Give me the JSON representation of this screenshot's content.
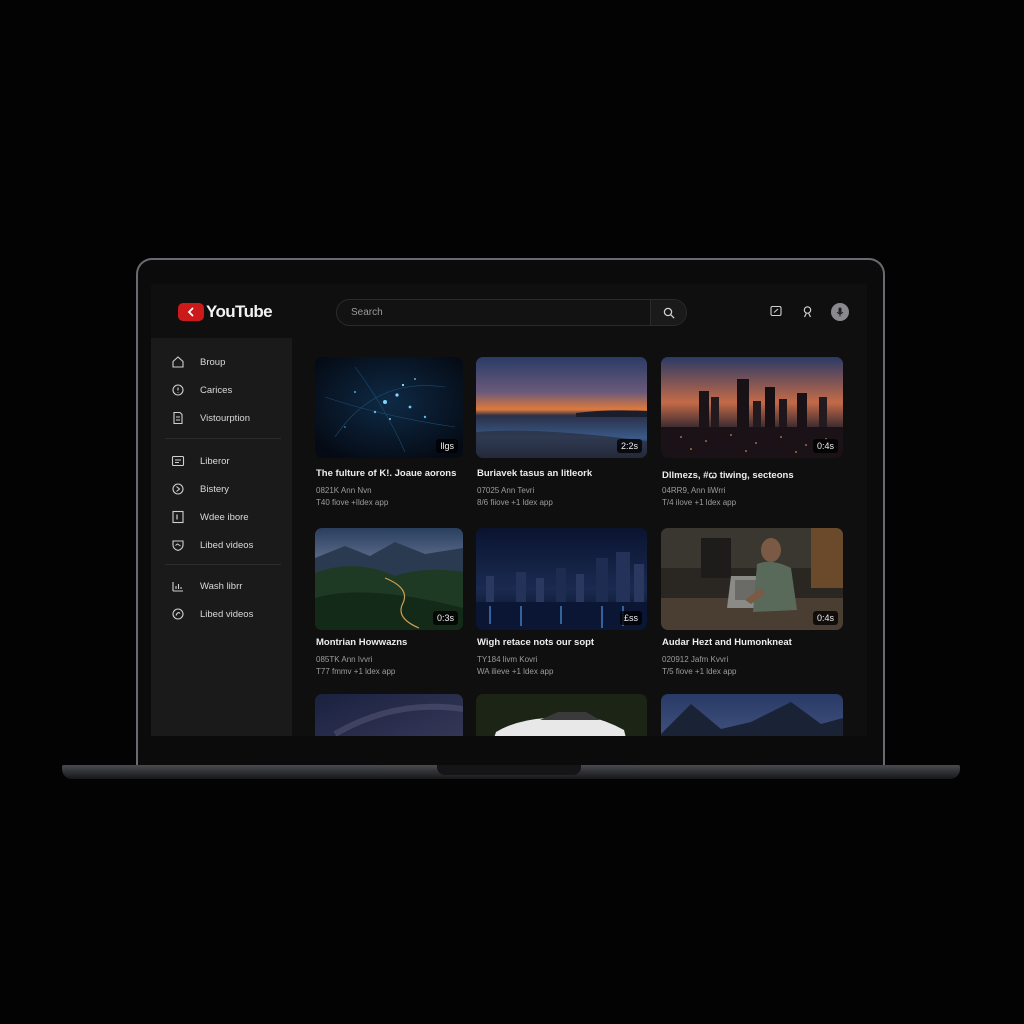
{
  "app": {
    "logo_text": "YouTube"
  },
  "search": {
    "placeholder": "Search"
  },
  "header_icons": [
    "create-icon",
    "account-icon",
    "avatar"
  ],
  "sidebar": {
    "items": [
      {
        "label": "Broup",
        "icon": "home-icon"
      },
      {
        "label": "Carices",
        "icon": "explore-icon"
      },
      {
        "label": "Vistourption",
        "icon": "subscriptions-icon"
      },
      {
        "label": "Liberor",
        "icon": "library-icon"
      },
      {
        "label": "Bistery",
        "icon": "history-icon"
      },
      {
        "label": "Wdee ibore",
        "icon": "your-videos-icon"
      },
      {
        "label": "Libed videos",
        "icon": "liked-videos-icon"
      },
      {
        "label": "Wash librr",
        "icon": "watch-later-icon"
      },
      {
        "label": "Libed videos",
        "icon": "liked-icon"
      }
    ]
  },
  "videos": [
    {
      "title": "The fulture of K!. Joaue aorons",
      "meta1": "0821K Ann  Nvn",
      "meta2": "T40  fiove  +Ildex app",
      "duration": "llgs"
    },
    {
      "title": "Buriavek tasus an litleork",
      "meta1": "07025 Ann Tevri",
      "meta2": "8/6 fiiove +1 ldex app",
      "duration": "2:2s"
    },
    {
      "title": "Dllmezs, #ꞷ tiwing, secteons",
      "meta1": "04RR9, Ann liWrri",
      "meta2": "T/4 ilove +1 ldex app",
      "duration": "0:4s"
    },
    {
      "title": "Montrian Howwazns",
      "meta1": "085TK Ann Ivvri",
      "meta2": "T77  fmmv  +1 ldex app",
      "duration": "0:3s"
    },
    {
      "title": "Wigh retace nots our sopt",
      "meta1": "TY184 livm Kovri",
      "meta2": "WA ilieve +1 ldex app",
      "duration": "£ss"
    },
    {
      "title": "Audar Hezt and Humonkneat",
      "meta1": "020912 Jafm Kvvri",
      "meta2": "T/5 fiove +1 ldex app",
      "duration": "0:4s"
    }
  ]
}
